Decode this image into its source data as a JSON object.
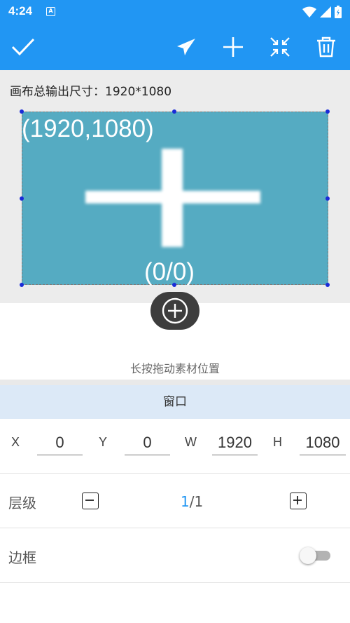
{
  "status_bar": {
    "time": "4:24",
    "notification_icon": "A",
    "icons": [
      "wifi-icon",
      "signal-icon",
      "battery-icon"
    ]
  },
  "toolbar": {
    "icons": [
      "check-icon",
      "send-icon",
      "add-icon",
      "collapse-icon",
      "delete-icon"
    ],
    "color": "#2196f3"
  },
  "canvas": {
    "output_size_text": "画布总输出尺寸：1920*1080",
    "preview": {
      "top_coord": "(1920,1080)",
      "bottom_coord": "(0/0)",
      "fill_color": "#55abc2"
    }
  },
  "hint": "长按拖动素材位置",
  "window_section": {
    "title": "窗口",
    "fields": {
      "x": {
        "label": "X",
        "value": "0"
      },
      "y": {
        "label": "Y",
        "value": "0"
      },
      "w": {
        "label": "W",
        "value": "1920"
      },
      "h": {
        "label": "H",
        "value": "1080"
      }
    }
  },
  "layer": {
    "label": "层级",
    "current": "1",
    "total": "/1"
  },
  "border": {
    "label": "边框",
    "enabled": false
  }
}
